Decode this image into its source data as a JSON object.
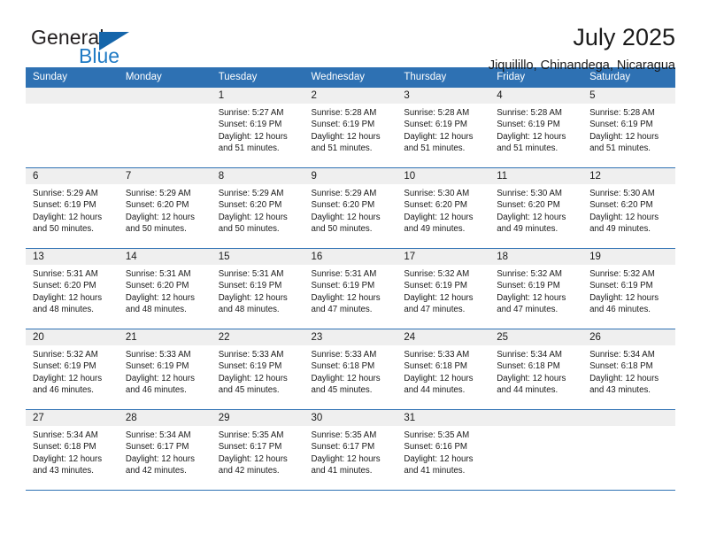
{
  "brand": {
    "name_top": "General",
    "name_bottom": "Blue",
    "accent_color": "#1f7ac4",
    "triangle_color": "#1565aa"
  },
  "header": {
    "title": "July 2025",
    "subtitle": "Jiquilillo, Chinandega, Nicaragua"
  },
  "theme": {
    "header_blue": "#2e71b3",
    "day_band_gray": "#efefef",
    "text": "#1a1a1a"
  },
  "weekday_headers": [
    "Sunday",
    "Monday",
    "Tuesday",
    "Wednesday",
    "Thursday",
    "Friday",
    "Saturday"
  ],
  "weeks": [
    [
      {
        "day": "",
        "sunrise": "",
        "sunset": "",
        "daylight": ""
      },
      {
        "day": "",
        "sunrise": "",
        "sunset": "",
        "daylight": ""
      },
      {
        "day": "1",
        "sunrise": "Sunrise: 5:27 AM",
        "sunset": "Sunset: 6:19 PM",
        "daylight": "Daylight: 12 hours and 51 minutes."
      },
      {
        "day": "2",
        "sunrise": "Sunrise: 5:28 AM",
        "sunset": "Sunset: 6:19 PM",
        "daylight": "Daylight: 12 hours and 51 minutes."
      },
      {
        "day": "3",
        "sunrise": "Sunrise: 5:28 AM",
        "sunset": "Sunset: 6:19 PM",
        "daylight": "Daylight: 12 hours and 51 minutes."
      },
      {
        "day": "4",
        "sunrise": "Sunrise: 5:28 AM",
        "sunset": "Sunset: 6:19 PM",
        "daylight": "Daylight: 12 hours and 51 minutes."
      },
      {
        "day": "5",
        "sunrise": "Sunrise: 5:28 AM",
        "sunset": "Sunset: 6:19 PM",
        "daylight": "Daylight: 12 hours and 51 minutes."
      }
    ],
    [
      {
        "day": "6",
        "sunrise": "Sunrise: 5:29 AM",
        "sunset": "Sunset: 6:19 PM",
        "daylight": "Daylight: 12 hours and 50 minutes."
      },
      {
        "day": "7",
        "sunrise": "Sunrise: 5:29 AM",
        "sunset": "Sunset: 6:20 PM",
        "daylight": "Daylight: 12 hours and 50 minutes."
      },
      {
        "day": "8",
        "sunrise": "Sunrise: 5:29 AM",
        "sunset": "Sunset: 6:20 PM",
        "daylight": "Daylight: 12 hours and 50 minutes."
      },
      {
        "day": "9",
        "sunrise": "Sunrise: 5:29 AM",
        "sunset": "Sunset: 6:20 PM",
        "daylight": "Daylight: 12 hours and 50 minutes."
      },
      {
        "day": "10",
        "sunrise": "Sunrise: 5:30 AM",
        "sunset": "Sunset: 6:20 PM",
        "daylight": "Daylight: 12 hours and 49 minutes."
      },
      {
        "day": "11",
        "sunrise": "Sunrise: 5:30 AM",
        "sunset": "Sunset: 6:20 PM",
        "daylight": "Daylight: 12 hours and 49 minutes."
      },
      {
        "day": "12",
        "sunrise": "Sunrise: 5:30 AM",
        "sunset": "Sunset: 6:20 PM",
        "daylight": "Daylight: 12 hours and 49 minutes."
      }
    ],
    [
      {
        "day": "13",
        "sunrise": "Sunrise: 5:31 AM",
        "sunset": "Sunset: 6:20 PM",
        "daylight": "Daylight: 12 hours and 48 minutes."
      },
      {
        "day": "14",
        "sunrise": "Sunrise: 5:31 AM",
        "sunset": "Sunset: 6:20 PM",
        "daylight": "Daylight: 12 hours and 48 minutes."
      },
      {
        "day": "15",
        "sunrise": "Sunrise: 5:31 AM",
        "sunset": "Sunset: 6:19 PM",
        "daylight": "Daylight: 12 hours and 48 minutes."
      },
      {
        "day": "16",
        "sunrise": "Sunrise: 5:31 AM",
        "sunset": "Sunset: 6:19 PM",
        "daylight": "Daylight: 12 hours and 47 minutes."
      },
      {
        "day": "17",
        "sunrise": "Sunrise: 5:32 AM",
        "sunset": "Sunset: 6:19 PM",
        "daylight": "Daylight: 12 hours and 47 minutes."
      },
      {
        "day": "18",
        "sunrise": "Sunrise: 5:32 AM",
        "sunset": "Sunset: 6:19 PM",
        "daylight": "Daylight: 12 hours and 47 minutes."
      },
      {
        "day": "19",
        "sunrise": "Sunrise: 5:32 AM",
        "sunset": "Sunset: 6:19 PM",
        "daylight": "Daylight: 12 hours and 46 minutes."
      }
    ],
    [
      {
        "day": "20",
        "sunrise": "Sunrise: 5:32 AM",
        "sunset": "Sunset: 6:19 PM",
        "daylight": "Daylight: 12 hours and 46 minutes."
      },
      {
        "day": "21",
        "sunrise": "Sunrise: 5:33 AM",
        "sunset": "Sunset: 6:19 PM",
        "daylight": "Daylight: 12 hours and 46 minutes."
      },
      {
        "day": "22",
        "sunrise": "Sunrise: 5:33 AM",
        "sunset": "Sunset: 6:19 PM",
        "daylight": "Daylight: 12 hours and 45 minutes."
      },
      {
        "day": "23",
        "sunrise": "Sunrise: 5:33 AM",
        "sunset": "Sunset: 6:18 PM",
        "daylight": "Daylight: 12 hours and 45 minutes."
      },
      {
        "day": "24",
        "sunrise": "Sunrise: 5:33 AM",
        "sunset": "Sunset: 6:18 PM",
        "daylight": "Daylight: 12 hours and 44 minutes."
      },
      {
        "day": "25",
        "sunrise": "Sunrise: 5:34 AM",
        "sunset": "Sunset: 6:18 PM",
        "daylight": "Daylight: 12 hours and 44 minutes."
      },
      {
        "day": "26",
        "sunrise": "Sunrise: 5:34 AM",
        "sunset": "Sunset: 6:18 PM",
        "daylight": "Daylight: 12 hours and 43 minutes."
      }
    ],
    [
      {
        "day": "27",
        "sunrise": "Sunrise: 5:34 AM",
        "sunset": "Sunset: 6:18 PM",
        "daylight": "Daylight: 12 hours and 43 minutes."
      },
      {
        "day": "28",
        "sunrise": "Sunrise: 5:34 AM",
        "sunset": "Sunset: 6:17 PM",
        "daylight": "Daylight: 12 hours and 42 minutes."
      },
      {
        "day": "29",
        "sunrise": "Sunrise: 5:35 AM",
        "sunset": "Sunset: 6:17 PM",
        "daylight": "Daylight: 12 hours and 42 minutes."
      },
      {
        "day": "30",
        "sunrise": "Sunrise: 5:35 AM",
        "sunset": "Sunset: 6:17 PM",
        "daylight": "Daylight: 12 hours and 41 minutes."
      },
      {
        "day": "31",
        "sunrise": "Sunrise: 5:35 AM",
        "sunset": "Sunset: 6:16 PM",
        "daylight": "Daylight: 12 hours and 41 minutes."
      },
      {
        "day": "",
        "sunrise": "",
        "sunset": "",
        "daylight": ""
      },
      {
        "day": "",
        "sunrise": "",
        "sunset": "",
        "daylight": ""
      }
    ]
  ]
}
